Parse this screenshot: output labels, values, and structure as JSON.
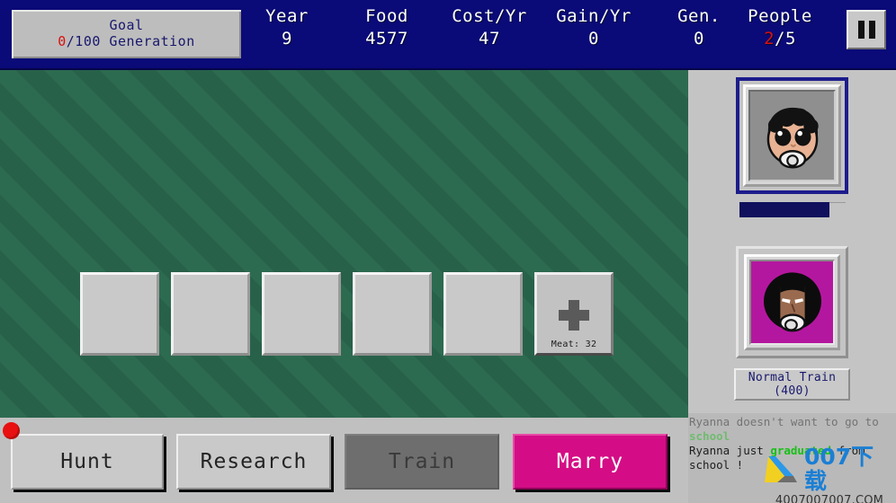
{
  "header": {
    "goal": {
      "title": "Goal",
      "current": "0",
      "rest": "/100 Generation"
    },
    "stats": [
      {
        "label": "Year",
        "value": "9",
        "highlight": false
      },
      {
        "label": "Food",
        "value": "4577",
        "highlight": false
      },
      {
        "label": "Cost/Yr",
        "value": "47",
        "highlight": false
      },
      {
        "label": "Gain/Yr",
        "value": "0",
        "highlight": false
      },
      {
        "label": "Gen.",
        "value": "0",
        "highlight": false
      }
    ],
    "people": {
      "label": "People",
      "current": "2",
      "rest": "/5"
    },
    "pause_icon": "pause-icon"
  },
  "play_area": {
    "slots": [
      "",
      "",
      "",
      "",
      ""
    ],
    "add_slot": {
      "icon": "plus-icon",
      "label": "Meat: 32"
    }
  },
  "sidebar": {
    "character_1": {
      "name": "baby-portrait",
      "selected": true,
      "progress_percent": 85
    },
    "character_2": {
      "name": "adult-portrait",
      "selected": false
    },
    "train_button": {
      "line1": "Normal Train",
      "line2": "(400)"
    }
  },
  "messages": [
    {
      "pre": "Ryanna doesn't want to go to ",
      "highlight": "school",
      "post": "",
      "faded": true
    },
    {
      "pre": "Ryanna just ",
      "highlight": "graduated",
      "post": " from school !",
      "faded": false
    }
  ],
  "actions": [
    {
      "id": "hunt",
      "label": "Hunt",
      "state": "normal"
    },
    {
      "id": "research",
      "label": "Research",
      "state": "normal"
    },
    {
      "id": "train",
      "label": "Train",
      "state": "disabled"
    },
    {
      "id": "marry",
      "label": "Marry",
      "state": "primary"
    }
  ],
  "notification_dot": {
    "name": "alert-dot",
    "color": "#e81010"
  },
  "watermark": {
    "text": "007下载",
    "url": "4007007007.COM"
  },
  "colors": {
    "header_bg": "#0a0a78",
    "play_bg": "#2d6b50",
    "sidebar_bg": "#c4c4c4",
    "accent_pink": "#d40d86",
    "alert_red": "#e81010",
    "highlight_green": "#17c017"
  }
}
